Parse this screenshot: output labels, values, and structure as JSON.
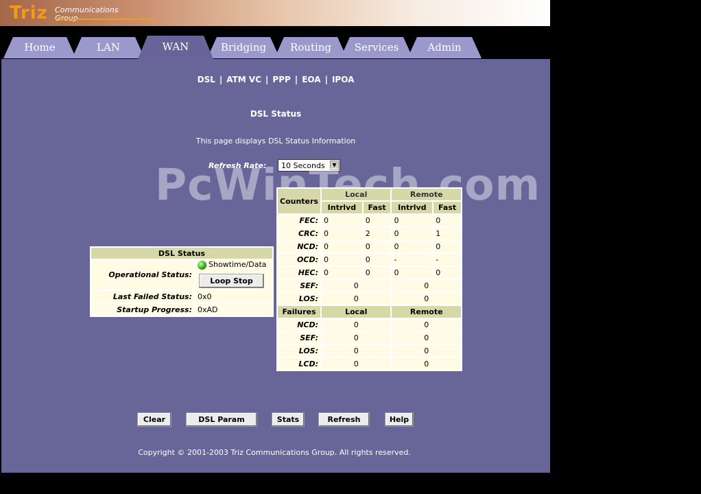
{
  "brand": {
    "name": "Triz",
    "line1": "Communications",
    "line2": "Group"
  },
  "tabs": [
    "Home",
    "LAN",
    "WAN",
    "Bridging",
    "Routing",
    "Services",
    "Admin"
  ],
  "active_tab": "WAN",
  "subnav": [
    "DSL",
    "ATM VC",
    "PPP",
    "EOA",
    "IPOA"
  ],
  "page_title": "DSL Status",
  "page_desc": "This page displays DSL Status Information",
  "refresh": {
    "label": "Refresh Rate:",
    "value": "10 Seconds"
  },
  "watermark": "PcWinTech.com",
  "dsl_status": {
    "header": "DSL Status",
    "operational_label": "Operational Status:",
    "operational_value": "Showtime/Data",
    "loop_button": "Loop Stop",
    "last_failed_label": "Last Failed Status:",
    "last_failed_value": "0x0",
    "startup_label": "Startup Progress:",
    "startup_value": "0xAD",
    "led_color": "#26a51b"
  },
  "counters": {
    "header": "Counters",
    "local": "Local",
    "remote": "Remote",
    "intrlvd": "Intrlvd",
    "fast": "Fast",
    "rows": [
      {
        "label": "FEC:",
        "li": "0",
        "lf": "0",
        "ri": "0",
        "rf": "0"
      },
      {
        "label": "CRC:",
        "li": "0",
        "lf": "2",
        "ri": "0",
        "rf": "1"
      },
      {
        "label": "NCD:",
        "li": "0",
        "lf": "0",
        "ri": "0",
        "rf": "0"
      },
      {
        "label": "OCD:",
        "li": "0",
        "lf": "0",
        "ri": "-",
        "rf": "-"
      },
      {
        "label": "HEC:",
        "li": "0",
        "lf": "0",
        "ri": "0",
        "rf": "0"
      }
    ],
    "merged_rows": [
      {
        "label": "SEF:",
        "local": "0",
        "remote": "0"
      },
      {
        "label": "LOS:",
        "local": "0",
        "remote": "0"
      }
    ]
  },
  "failures": {
    "header": "Failures",
    "local": "Local",
    "remote": "Remote",
    "rows": [
      {
        "label": "NCD:",
        "local": "0",
        "remote": "0"
      },
      {
        "label": "SEF:",
        "local": "0",
        "remote": "0"
      },
      {
        "label": "LOS:",
        "local": "0",
        "remote": "0"
      },
      {
        "label": "LCD:",
        "local": "0",
        "remote": "0"
      }
    ]
  },
  "buttons": [
    "Clear",
    "DSL Param",
    "Stats",
    "Refresh",
    "Help"
  ],
  "footer": "Copyright © 2001-2003 Triz Communications Group. All rights reserved.",
  "colors": {
    "panel": "#686699",
    "tab": "#9b99cb",
    "table_header": "#d7d8a8",
    "table_cell": "#fffbe4",
    "logo_accent": "#f39a1b"
  }
}
